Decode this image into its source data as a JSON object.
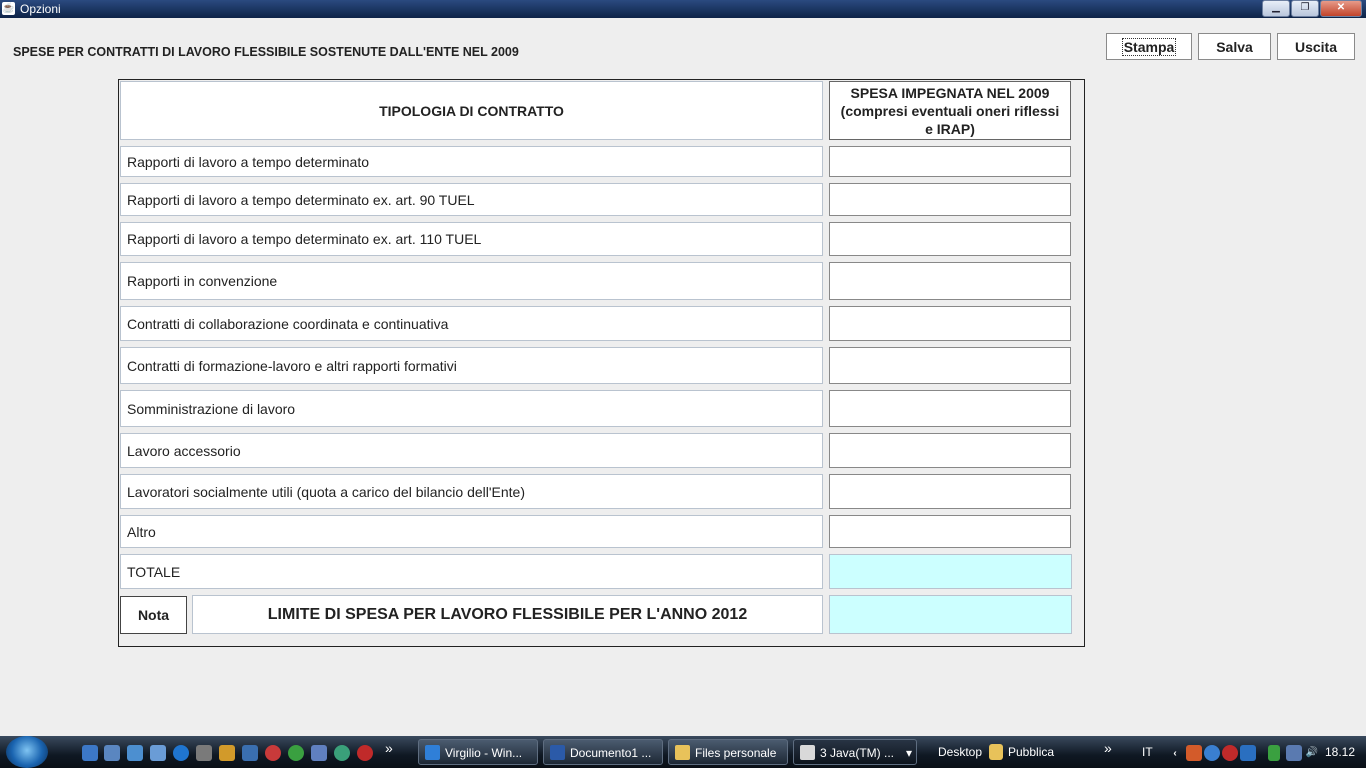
{
  "window": {
    "title": "Opzioni",
    "controls": {
      "minimize": "▁",
      "maximize": "❐",
      "close": "✕"
    }
  },
  "heading": "SPESE PER CONTRATTI DI LAVORO FLESSIBILE SOSTENUTE DALL'ENTE NEL 2009",
  "buttons": {
    "stampa": "Stampa",
    "salva": "Salva",
    "uscita": "Uscita"
  },
  "table": {
    "col1_header": "TIPOLOGIA DI CONTRATTO",
    "col2_header_line1": "SPESA IMPEGNATA NEL 2009",
    "col2_header_line2": "(compresi eventuali oneri riflessi",
    "col2_header_line3": "e IRAP)",
    "rows": [
      {
        "label": "Rapporti di lavoro a tempo determinato",
        "value": ""
      },
      {
        "label": "Rapporti di lavoro a tempo determinato ex. art. 90 TUEL",
        "value": ""
      },
      {
        "label": "Rapporti di lavoro a tempo determinato ex. art. 110 TUEL",
        "value": ""
      },
      {
        "label": "Rapporti in convenzione",
        "value": ""
      },
      {
        "label": "Contratti di collaborazione coordinata e continuativa",
        "value": ""
      },
      {
        "label": "Contratti di formazione-lavoro e altri rapporti formativi",
        "value": ""
      },
      {
        "label": "Somministrazione di lavoro",
        "value": ""
      },
      {
        "label": "Lavoro accessorio",
        "value": ""
      },
      {
        "label": "Lavoratori socialmente utili (quota a carico del bilancio dell'Ente)",
        "value": ""
      },
      {
        "label": "Altro",
        "value": ""
      }
    ],
    "total_label": "TOTALE",
    "total_value": "",
    "nota_button": "Nota",
    "limit_label": "LIMITE DI SPESA PER LAVORO FLESSIBILE PER L'ANNO 2012",
    "limit_value": ""
  },
  "taskbar": {
    "tasks": [
      {
        "label": "Virgilio - Win...",
        "icon_color": "#2f7fd8"
      },
      {
        "label": "Documento1 ...",
        "icon_color": "#2b5aa8"
      },
      {
        "label": "Files personale",
        "icon_color": "#e8c25a"
      },
      {
        "label": "3 Java(TM) ...",
        "icon_color": "#d9d9d9"
      }
    ],
    "arrow_down": "▾",
    "toolbar_chevron": "»",
    "desktop_label": "Desktop",
    "pubblica_label": "Pubblica",
    "lang": "IT",
    "clock": "18.12"
  }
}
